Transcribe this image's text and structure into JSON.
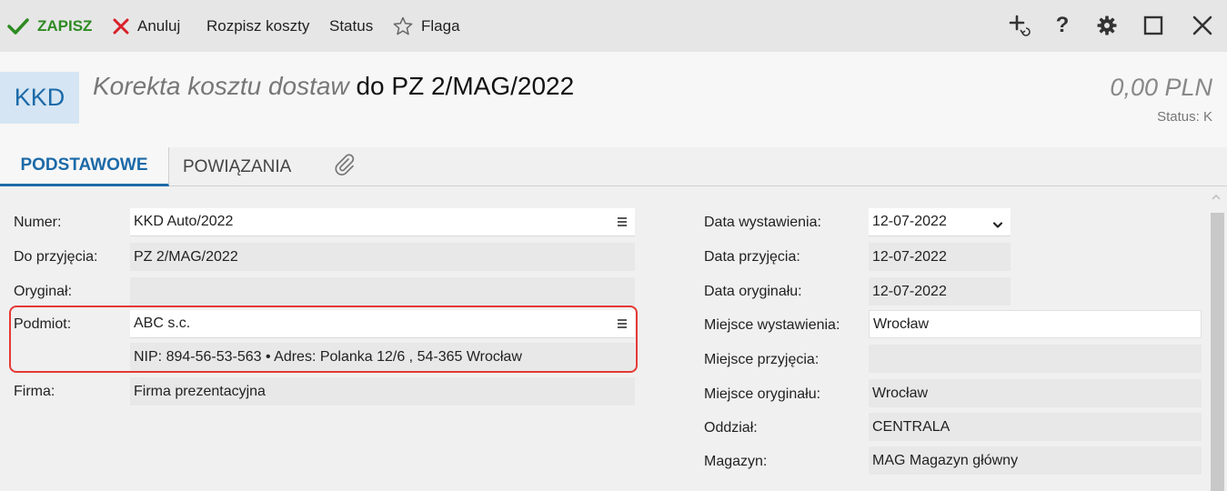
{
  "toolbar": {
    "save_label": "ZAPISZ",
    "cancel_label": "Anuluj",
    "split_costs_label": "Rozpisz koszty",
    "status_label": "Status",
    "flag_label": "Flaga",
    "help_label": "?"
  },
  "header": {
    "doc_code": "KKD",
    "doc_kind": "Korekta kosztu dostaw",
    "doc_ref": "do PZ 2/MAG/2022",
    "amount": "0,00 PLN",
    "status": "Status: K"
  },
  "tabs": {
    "basic": "PODSTAWOWE",
    "relations": "POWIĄZANIA"
  },
  "form_left": {
    "numer_label": "Numer:",
    "numer_value": "KKD Auto/2022",
    "do_przyjecia_label": "Do przyjęcia:",
    "do_przyjecia_value": "PZ 2/MAG/2022",
    "oryginal_label": "Oryginał:",
    "oryginal_value": "",
    "podmiot_label": "Podmiot:",
    "podmiot_value": "ABC s.c.",
    "podmiot_details": "NIP:  894-56-53-563  •  Adres:  Polanka  12/6 , 54-365 Wrocław",
    "firma_label": "Firma:",
    "firma_value": "Firma prezentacyjna"
  },
  "form_right": {
    "data_wystawienia_label": "Data wystawienia:",
    "data_wystawienia_value": "12-07-2022",
    "data_przyjecia_label": "Data przyjęcia:",
    "data_przyjecia_value": "12-07-2022",
    "data_oryginalu_label": "Data oryginału:",
    "data_oryginalu_value": "12-07-2022",
    "miejsce_wystawienia_label": "Miejsce wystawienia:",
    "miejsce_wystawienia_value": "Wrocław",
    "miejsce_przyjecia_label": "Miejsce przyjęcia:",
    "miejsce_przyjecia_value": "",
    "miejsce_oryginalu_label": "Miejsce oryginału:",
    "miejsce_oryginalu_value": "Wrocław",
    "oddzial_label": "Oddział:",
    "oddzial_value": "CENTRALA",
    "magazyn_label": "Magazyn:",
    "magazyn_value": "MAG Magazyn główny"
  },
  "icons": {
    "save": "checkmark-icon",
    "cancel": "close-x-icon",
    "flag": "star-icon",
    "add": "add-plus-icon",
    "help": "question-icon",
    "settings": "gear-icon",
    "maximize": "maximize-icon",
    "close": "close-icon",
    "attachment": "paperclip-icon",
    "menu": "menu-lines-icon",
    "dropdown": "chevron-down-icon"
  },
  "colors": {
    "accent": "#1c6aa8",
    "save_green": "#2e8b22",
    "cancel_red": "#d9202a",
    "highlight_red": "#e53935"
  }
}
